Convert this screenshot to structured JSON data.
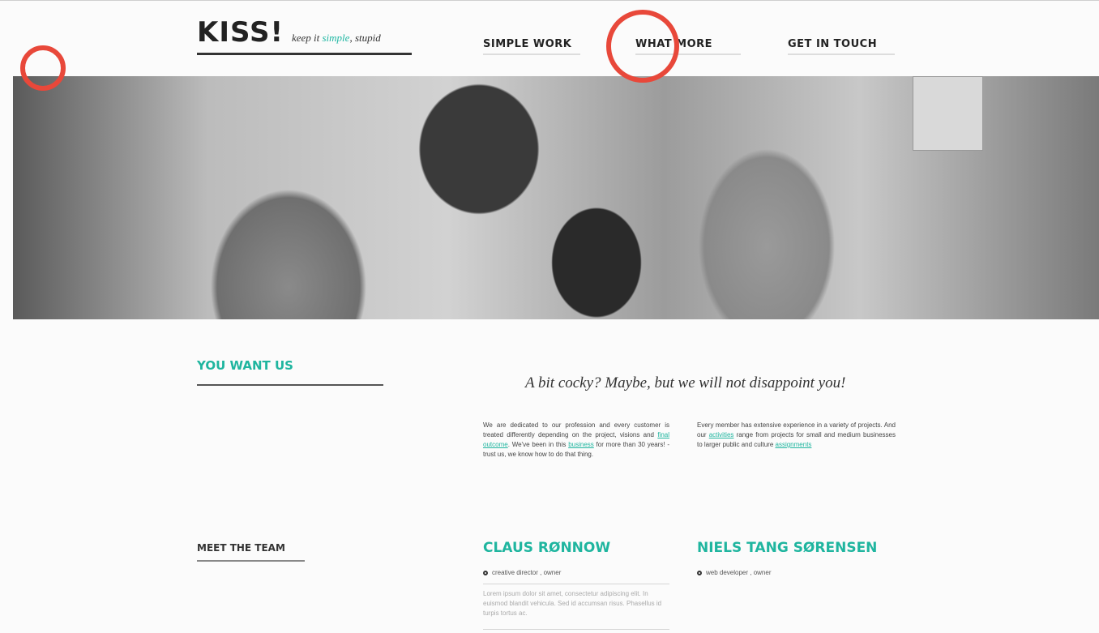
{
  "header": {
    "logo": "KISS!",
    "tagline_pre": "keep it ",
    "tagline_accent": "simple",
    "tagline_post": ", stupid"
  },
  "nav": [
    {
      "label": "SIMPLE WORK"
    },
    {
      "label": "WHAT MORE"
    },
    {
      "label": "GET IN TOUCH"
    }
  ],
  "sections": {
    "you_want_us": "YOU WANT US",
    "meet_team": "MEET THE TEAM"
  },
  "tagline": "A bit cocky? Maybe, but we will not disappoint you!",
  "paragraph1": {
    "t1": "We are dedicated to our profession and every customer is treated differently depending on the project, visions and ",
    "link1": "final outcome",
    "t2": ". We've been in this ",
    "link2": "business",
    "t3": " for more than 30 years! - trust us, we know how to do that thing."
  },
  "paragraph2": {
    "t1": "Every member has extensive experience in a variety of projects. And our ",
    "link1": "activities",
    "t2": " range from projects for small and medium businesses to larger public and culture ",
    "link2": "assignments"
  },
  "team": [
    {
      "name": "CLAUS RØNNOW",
      "role": "creative director , owner",
      "bio": "Lorem ipsum dolor sit amet, consectetur adipiscing elit. In euismod blandit vehicula. Sed id accumsan risus. Phasellus id turpis tortus ac."
    },
    {
      "name": "NIELS TANG SØRENSEN",
      "role": "web developer , owner"
    }
  ],
  "colors": {
    "accent": "#1fb59f",
    "annotation": "#e8483a"
  }
}
